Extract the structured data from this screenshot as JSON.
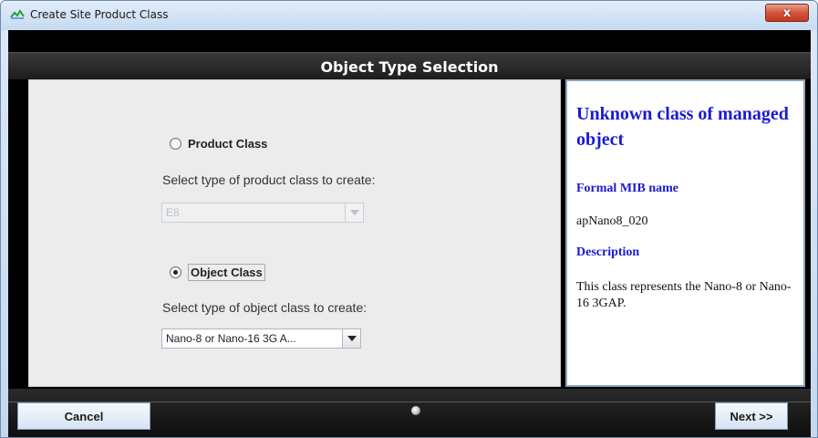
{
  "window": {
    "title": "Create Site Product Class",
    "close_glyph": "x"
  },
  "header": {
    "title": "Object Type Selection"
  },
  "product_class": {
    "label": "Product Class",
    "prompt": "Select type of product class to create:",
    "selected": "E8",
    "enabled": false,
    "checked": false
  },
  "object_class": {
    "label": "Object Class",
    "prompt": "Select type of object class to create:",
    "selected": "Nano-8 or Nano-16 3G A...",
    "enabled": true,
    "checked": true
  },
  "info": {
    "heading": "Unknown class of managed object",
    "mib_label": "Formal MIB name",
    "mib_value": "apNano8_020",
    "description_label": "Description",
    "description_text": "This class represents the Nano-8 or Nano-16 3GAP."
  },
  "footer": {
    "cancel_label": "Cancel",
    "next_label": "Next >>"
  },
  "colors": {
    "info_heading": "#1a1ad0",
    "header_bg": "#1c1c1c",
    "close_button": "#c13a21"
  },
  "icons": [
    "app-icon",
    "close-icon",
    "radio-button-icon",
    "dropdown-arrow-icon",
    "status-indicator-icon"
  ]
}
